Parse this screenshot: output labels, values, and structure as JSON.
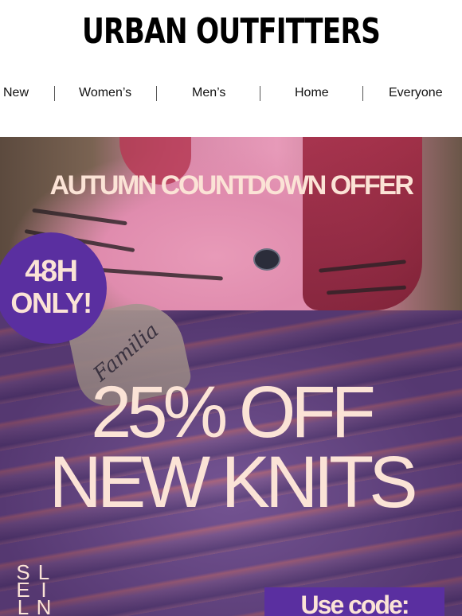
{
  "brand": {
    "logo": "URBAN OUTFITTERS"
  },
  "nav": {
    "items": [
      {
        "label": "New"
      },
      {
        "label": "Women’s"
      },
      {
        "label": "Men’s"
      },
      {
        "label": "Home"
      },
      {
        "label": "Everyone"
      }
    ]
  },
  "hero": {
    "offer_title": "AUTUMN COUNTDOWN OFFER",
    "badge": {
      "line1": "48H",
      "line2": "ONLY!"
    },
    "tattoo_text": "Familia",
    "headline_line1": "25% OFF",
    "headline_line2": "NEW KNITS",
    "vertical_text_col1": [
      "S",
      "E",
      "L"
    ],
    "vertical_text_col2": [
      "L",
      "I",
      "N"
    ],
    "code_label": "Use code:"
  },
  "colors": {
    "accent_purple": "#5a2fa0",
    "headline_peach": "#fbe3d6"
  }
}
